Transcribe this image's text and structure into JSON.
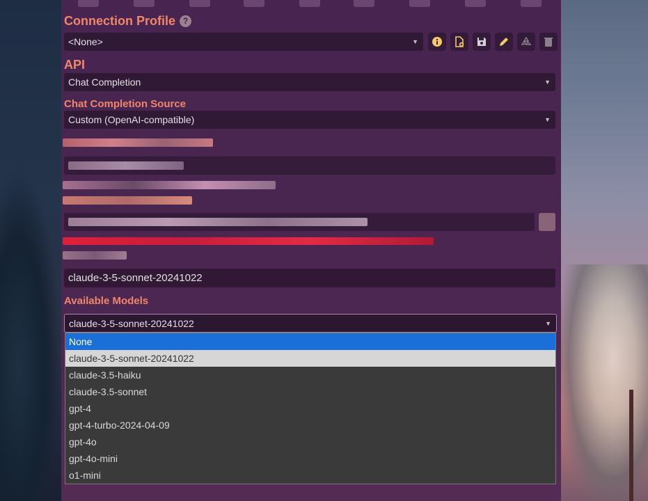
{
  "connection_profile": {
    "title": "Connection Profile",
    "help": "?",
    "value": "<None>"
  },
  "api": {
    "title": "API",
    "value": "Chat Completion"
  },
  "source": {
    "title": "Chat Completion Source",
    "value": "Custom (OpenAI-compatible)"
  },
  "model_input": {
    "value": "claude-3-5-sonnet-20241022"
  },
  "available_models": {
    "title": "Available Models",
    "selected": "claude-3-5-sonnet-20241022",
    "options": [
      "None",
      "claude-3-5-sonnet-20241022",
      "claude-3.5-haiku",
      "claude-3.5-sonnet",
      "gpt-4",
      "gpt-4-turbo-2024-04-09",
      "gpt-4o",
      "gpt-4o-mini",
      "o1-mini"
    ],
    "highlighted_index": 0,
    "selected_index": 1
  },
  "colors": {
    "accent": "#f0866a",
    "highlight": "#1a6fd8",
    "panel": "#4a2550"
  },
  "icons": [
    "info-icon",
    "file-add-icon",
    "save-icon",
    "pencil-icon",
    "recycle-icon",
    "trash-icon"
  ]
}
